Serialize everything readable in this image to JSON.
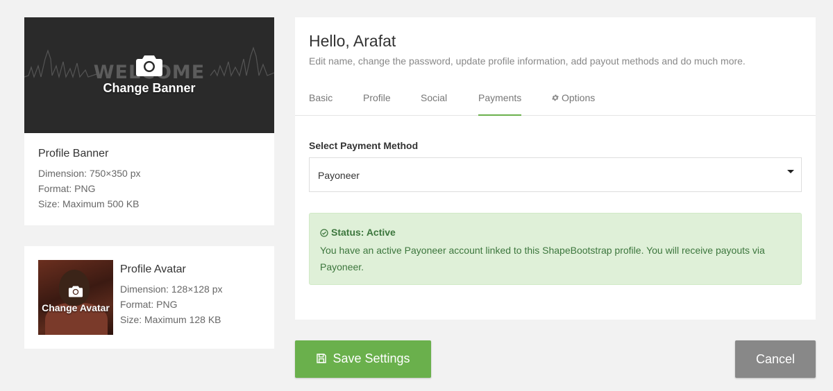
{
  "banner": {
    "overlay_text": "WELCOME",
    "change_label": "Change Banner",
    "title": "Profile Banner",
    "dimension": "Dimension: 750×350 px",
    "format": "Format: PNG",
    "size": "Size: Maximum 500 KB"
  },
  "avatar": {
    "change_label": "Change Avatar",
    "title": "Profile Avatar",
    "dimension": "Dimension: 128×128 px",
    "format": "Format: PNG",
    "size": "Size: Maximum 128 KB"
  },
  "header": {
    "greeting": "Hello, Arafat",
    "subtitle": "Edit name, change the password, update profile information, add payout methods and do much more."
  },
  "tabs": [
    {
      "label": "Basic",
      "active": false
    },
    {
      "label": "Profile",
      "active": false
    },
    {
      "label": "Social",
      "active": false
    },
    {
      "label": "Payments",
      "active": true
    },
    {
      "label": "Options",
      "active": false,
      "icon": "gear-icon"
    }
  ],
  "payment": {
    "field_label": "Select Payment Method",
    "selected": "Payoneer"
  },
  "status": {
    "title": "Status: Active",
    "message": "You have an active Payoneer account linked to this ShapeBootstrap profile. You will receive payouts via Payoneer."
  },
  "actions": {
    "save_label": "Save Settings",
    "cancel_label": "Cancel"
  },
  "colors": {
    "accent": "#6ab04c",
    "alert_bg": "#dff0d8",
    "alert_text": "#3c763d",
    "cancel_bg": "#888888",
    "banner_bg": "#2a2a2a"
  }
}
